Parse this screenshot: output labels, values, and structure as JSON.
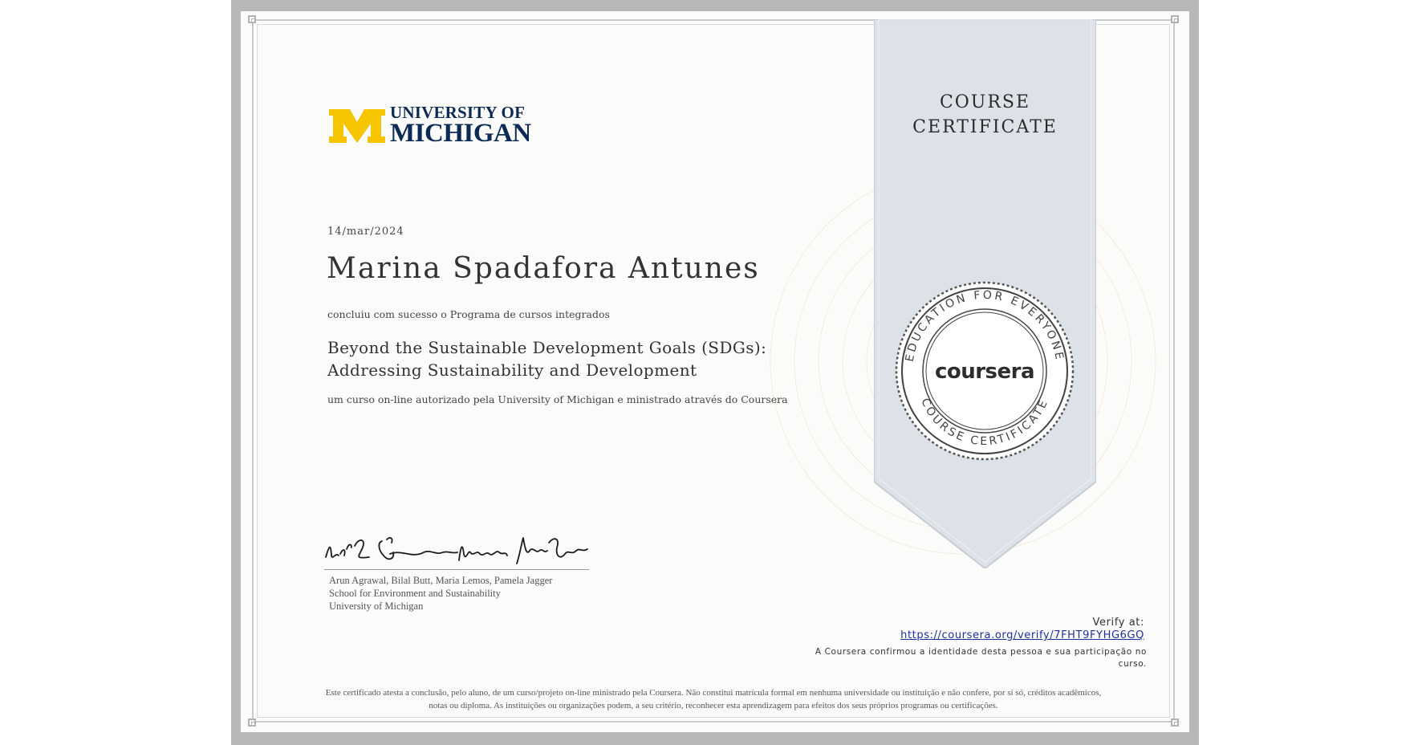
{
  "certificate": {
    "ribbon_title_line1": "COURSE",
    "ribbon_title_line2": "CERTIFICATE",
    "logo": {
      "line1": "UNIVERSITY OF",
      "line2": "MICHIGAN",
      "brand_blue": "#0b2a54",
      "brand_maize": "#f6c500"
    },
    "date": "14/mar/2024",
    "recipient_name": "Marina Spadafora Antunes",
    "completed_text": "concluiu com sucesso o Programa de cursos integrados",
    "course_title_line1": "Beyond the Sustainable Development Goals (SDGs):",
    "course_title_line2": "Addressing Sustainability and Development",
    "authorized_text": "um curso on-line autorizado pela University of Michigan e ministrado através do Coursera",
    "signers_line1": "Arun Agrawal, Bilal Butt, Maria Lemos, Pamela Jagger",
    "signers_line2": "School for Environment and Sustainability",
    "signers_line3": "University of Michigan",
    "verify_label": "Verify at:",
    "verify_url": "https://coursera.org/verify/7FHT9FYHG6GQ",
    "confirm_text": "A Coursera confirmou a identidade desta pessoa e sua participação no curso.",
    "disclaimer_line1": "Este certificado atesta a conclusão, pelo aluno, de um curso/projeto on-line ministrado pela Coursera. Não constitui matrícula formal em nenhuma universidade ou instituição e não confere, por si só, créditos acadêmicos,",
    "disclaimer_line2": "notas ou diploma. As instituições ou organizações podem, a seu critério, reconhecer esta aprendizagem para efeitos dos seus próprios programas ou certificações.",
    "seal": {
      "brand": "coursera",
      "ring_top": "EDUCATION FOR EVERYONE",
      "ring_bottom": "COURSE CERTIFICATE"
    }
  }
}
